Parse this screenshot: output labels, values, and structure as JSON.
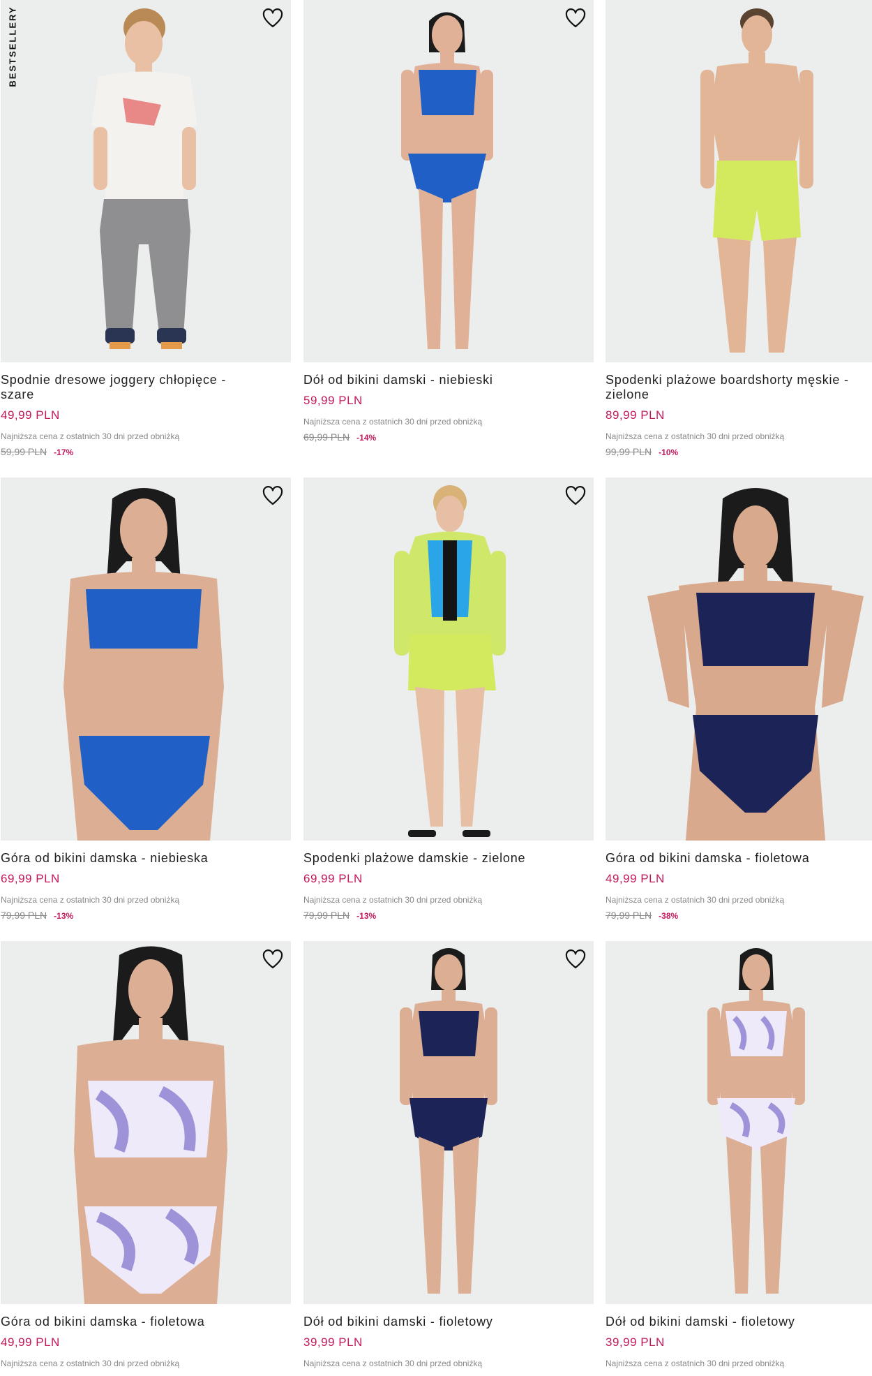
{
  "badges": {
    "bestsellers": "BESTSELLERY"
  },
  "lowest_price_note": "Najniższa cena z ostatnich 30 dni przed obniżką",
  "products": [
    {
      "name": "Spodnie dresowe joggery chłopięce - szare",
      "price": "49,99 PLN",
      "old_price": "59,99 PLN",
      "discount": "-17%"
    },
    {
      "name": "Dół od bikini damski - niebieski",
      "price": "59,99 PLN",
      "old_price": "69,99 PLN",
      "discount": "-14%"
    },
    {
      "name": "Spodenki plażowe boardshorty męskie - zielone",
      "price": "89,99 PLN",
      "old_price": "99,99 PLN",
      "discount": "-10%"
    },
    {
      "name": "Góra od bikini damska - niebieska",
      "price": "69,99 PLN",
      "old_price": "79,99 PLN",
      "discount": "-13%"
    },
    {
      "name": "Spodenki plażowe damskie - zielone",
      "price": "69,99 PLN",
      "old_price": "79,99 PLN",
      "discount": "-13%"
    },
    {
      "name": "Góra od bikini damska - fioletowa",
      "price": "49,99 PLN",
      "old_price": "79,99 PLN",
      "discount": "-38%"
    },
    {
      "name": "Góra od bikini damska - fioletowa",
      "price": "49,99 PLN"
    },
    {
      "name": "Dół od bikini damski - fioletowy",
      "price": "39,99 PLN"
    },
    {
      "name": "Dół od bikini damski - fioletowy",
      "price": "39,99 PLN"
    }
  ],
  "colors": {
    "price": "#c2185b",
    "image_bg": "#eceded",
    "skin": "#e0b197",
    "royal_blue": "#1f5fc6",
    "lime": "#d3ea5f",
    "navy": "#1c2457",
    "lilac": "#9e92d8"
  },
  "icons": {
    "wishlist": "heart-outline-icon"
  }
}
